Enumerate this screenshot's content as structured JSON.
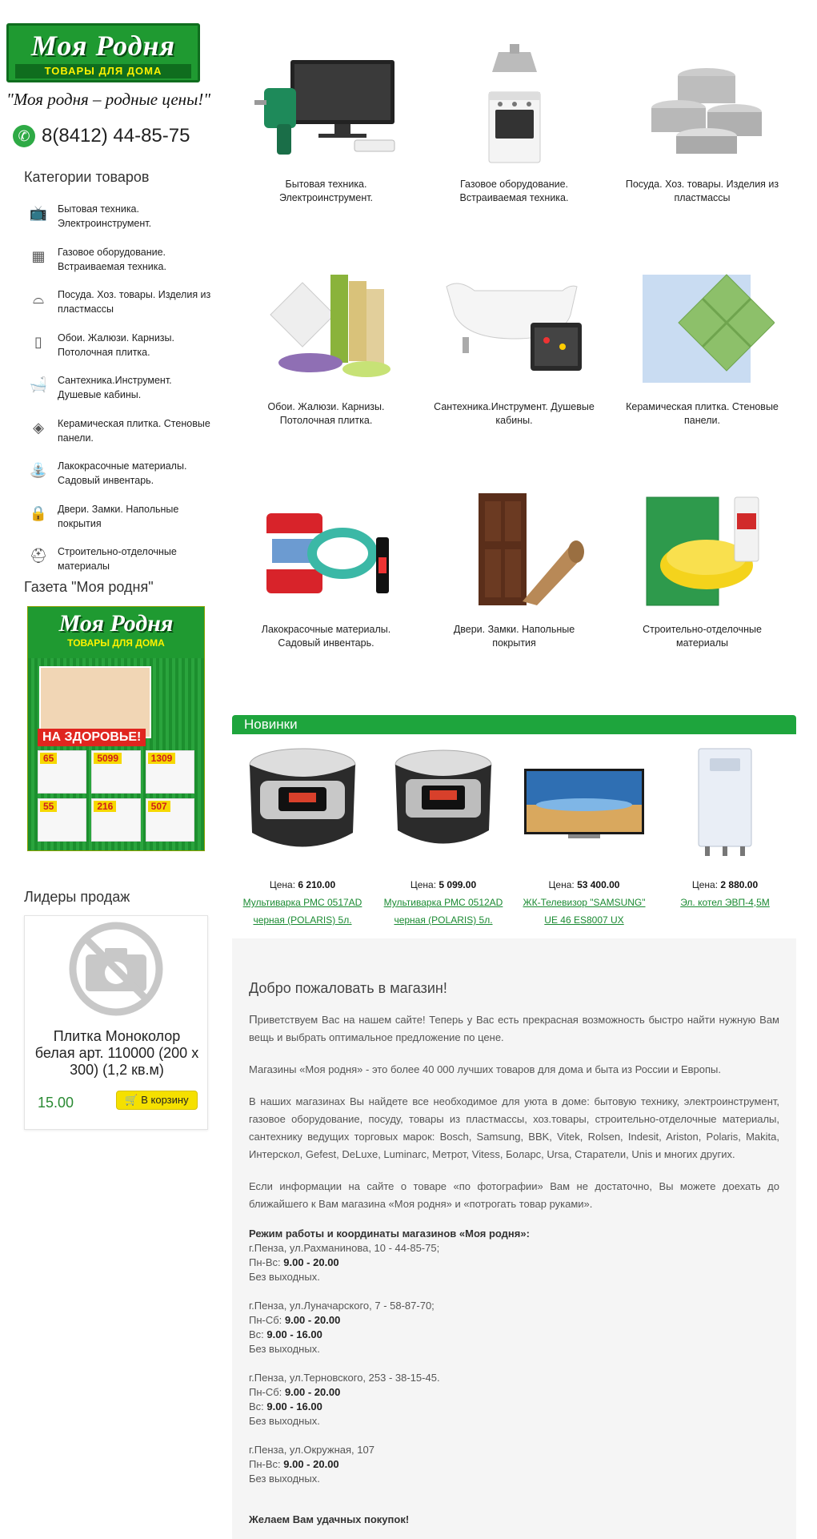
{
  "header": {
    "logo_name": "Моя Родня",
    "logo_sub": "ТОВАРЫ ДЛЯ ДОМА",
    "slogan": "\"Моя родня – родные цены!\"",
    "phone": "8(8412) 44-85-75"
  },
  "sidebar": {
    "categories_title": "Категории товаров",
    "categories": [
      {
        "label": "Бытовая техника. Электроинструмент.",
        "icon": "tv-icon"
      },
      {
        "label": "Газовое оборудование. Встраиваемая техника.",
        "icon": "stove-icon"
      },
      {
        "label": "Посуда. Хоз. товары. Изделия из пластмассы",
        "icon": "pot-icon"
      },
      {
        "label": "Обои. Жалюзи. Карнизы. Потолочная плитка.",
        "icon": "wallpaper-icon"
      },
      {
        "label": "Сантехника.Инструмент. Душевые кабины.",
        "icon": "bathtub-icon"
      },
      {
        "label": "Керамическая плитка. Стеновые панели.",
        "icon": "tile-icon"
      },
      {
        "label": "Лакокрасочные материалы. Садовый инвентарь.",
        "icon": "watering-can-icon"
      },
      {
        "label": "Двери. Замки. Напольные покрытия",
        "icon": "lock-icon"
      },
      {
        "label": "Строительно-отделочные материалы",
        "icon": "helmet-icon"
      }
    ],
    "newspaper_title": "Газета \"Моя родня\"",
    "newspaper": {
      "name": "Моя Родня",
      "sub": "ТОВАРЫ ДЛЯ ДОМА",
      "banner": "НА ЗДОРОВЬЕ!",
      "prices": [
        "65",
        "5099",
        "1309",
        "55",
        "216",
        "507"
      ]
    },
    "leaders_title": "Лидеры продаж",
    "leader": {
      "title": "Плитка Моноколор белая арт. 110000 (200 х 300) (1,2 кв.м)",
      "price": "15.00",
      "cart_label": "В корзину"
    }
  },
  "category_grid": [
    {
      "label": "Бытовая техника. Электроинструмент."
    },
    {
      "label": "Газовое оборудование. Встраиваемая техника."
    },
    {
      "label": "Посуда. Хоз. товары. Изделия из пластмассы"
    },
    {
      "label": "Обои. Жалюзи. Карнизы. Потолочная плитка."
    },
    {
      "label": "Сантехника.Инструмент. Душевые кабины."
    },
    {
      "label": "Керамическая плитка. Стеновые панели."
    },
    {
      "label": "Лакокрасочные материалы. Садовый инвентарь."
    },
    {
      "label": "Двери. Замки. Напольные покрытия"
    },
    {
      "label": "Строительно-отделочные материалы"
    }
  ],
  "new_items": {
    "title": "Новинки",
    "price_label": "Цена:",
    "items": [
      {
        "price": "6 210.00",
        "name": "Мультиварка РМС 0517AD черная (POLARIS) 5л."
      },
      {
        "price": "5 099.00",
        "name": "Мультиварка РМС 0512AD черная (POLARIS) 5л."
      },
      {
        "price": "53 400.00",
        "name": "ЖК-Телевизор \"SAMSUNG\" UE 46 ES8007 UX"
      },
      {
        "price": "2 880.00",
        "name": "Эл. котел ЭВП-4,5М"
      }
    ]
  },
  "welcome": {
    "title": "Добро пожаловать в магазин!",
    "paragraphs": [
      "Приветствуем Вас на нашем сайте! Теперь у Вас есть прекрасная возможность быстро найти нужную Вам вещь и выбрать оптимальное предложение по цене.",
      "Магазины «Моя родня» - это более 40 000 лучших товаров для дома и быта из России и Европы.",
      "В наших магазинах Вы найдете все необходимое для уюта в доме: бытовую технику, электроинструмент, газовое оборудование, посуду, товары из пластмассы, хоз.товары, строительно-отделочные материалы, сантехнику ведущих торговых марок: Bosch, Samsung, BBK, Vitek, Rolsen, Indesit, Ariston, Polaris, Makita, Интерскол, Gefest, DeLuxe, Luminarc, Метрот, Vitess, Боларс, Ursa, Старатели, Unis и многих других.",
      "Если информации на сайте о товаре «по фотографии» Вам не достаточно, Вы можете доехать до ближайшего к Вам магазина «Моя родня» и «потрогать товар руками»."
    ],
    "shops_title": "Режим работы и координаты магазинов «Моя родня»:",
    "shops": [
      {
        "address": "г.Пенза, ул.Рахманинова, 10 - 44-85-75;",
        "hours": [
          {
            "days": "Пн-Вс:",
            "time": "9.00 - 20.00"
          }
        ],
        "note": "Без выходных."
      },
      {
        "address": "г.Пенза, ул.Луначарского, 7 - 58-87-70;",
        "hours": [
          {
            "days": "Пн-Сб:",
            "time": "9.00 - 20.00"
          },
          {
            "days": "Вс:",
            "time": "9.00 - 16.00"
          }
        ],
        "note": "Без выходных."
      },
      {
        "address": "г.Пенза, ул.Терновского, 253 - 38-15-45.",
        "hours": [
          {
            "days": "Пн-Сб:",
            "time": "9.00 - 20.00"
          },
          {
            "days": "Вс:",
            "time": "9.00 - 16.00"
          }
        ],
        "note": "Без выходных."
      },
      {
        "address": "г.Пенза, ул.Окружная, 107",
        "hours": [
          {
            "days": "Пн-Вс:",
            "time": "9.00 - 20.00"
          }
        ],
        "note": "Без выходных."
      }
    ],
    "farewell": "Желаем Вам удачных покупок!"
  },
  "colors": {
    "brand_green": "#1ea53d",
    "link_green": "#1a8a32",
    "cart_yellow": "#f5e000"
  }
}
